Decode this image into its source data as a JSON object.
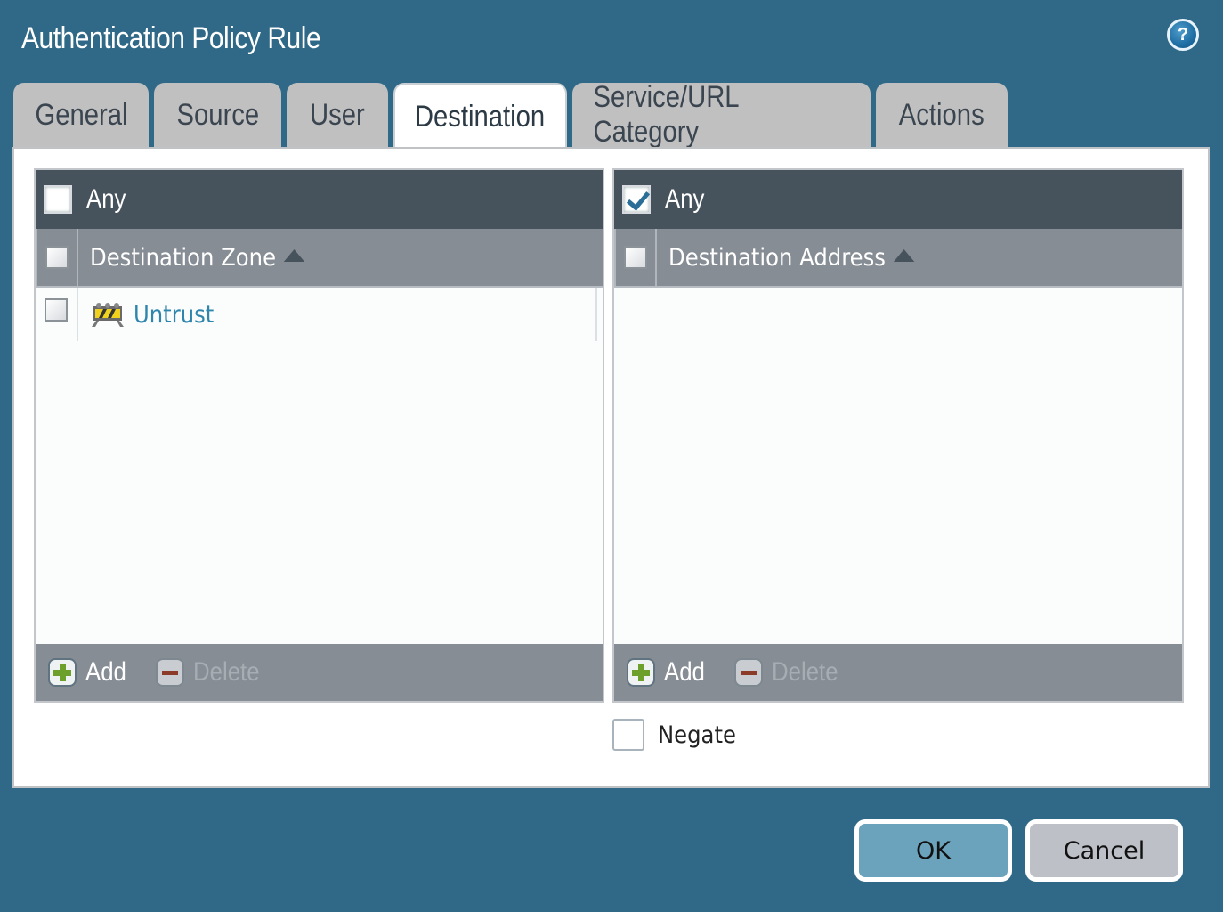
{
  "dialog": {
    "title": "Authentication Policy Rule",
    "help_icon": "?"
  },
  "tabs": [
    {
      "label": "General",
      "active": false
    },
    {
      "label": "Source",
      "active": false
    },
    {
      "label": "User",
      "active": false
    },
    {
      "label": "Destination",
      "active": true
    },
    {
      "label": "Service/URL Category",
      "active": false
    },
    {
      "label": "Actions",
      "active": false
    }
  ],
  "zone_grid": {
    "any_label": "Any",
    "any_checked": false,
    "column_header": "Destination Zone",
    "sort": "ascending",
    "rows": [
      {
        "name": "Untrust",
        "icon": "zone-barrier-icon",
        "checked": false
      }
    ],
    "add_label": "Add",
    "delete_label": "Delete",
    "delete_enabled": false
  },
  "address_grid": {
    "any_label": "Any",
    "any_checked": true,
    "column_header": "Destination Address",
    "sort": "ascending",
    "rows": [],
    "add_label": "Add",
    "delete_label": "Delete",
    "delete_enabled": false
  },
  "negate": {
    "label": "Negate",
    "checked": false
  },
  "buttons": {
    "ok": "OK",
    "cancel": "Cancel"
  },
  "colors": {
    "background": "#306987",
    "tab_inactive": "#c0c0c0",
    "grid_any_bar": "#46525c",
    "grid_header": "#868d94",
    "link": "#2f86ad",
    "ok_button": "#6ba3bc",
    "cancel_button": "#bdc0c6"
  }
}
